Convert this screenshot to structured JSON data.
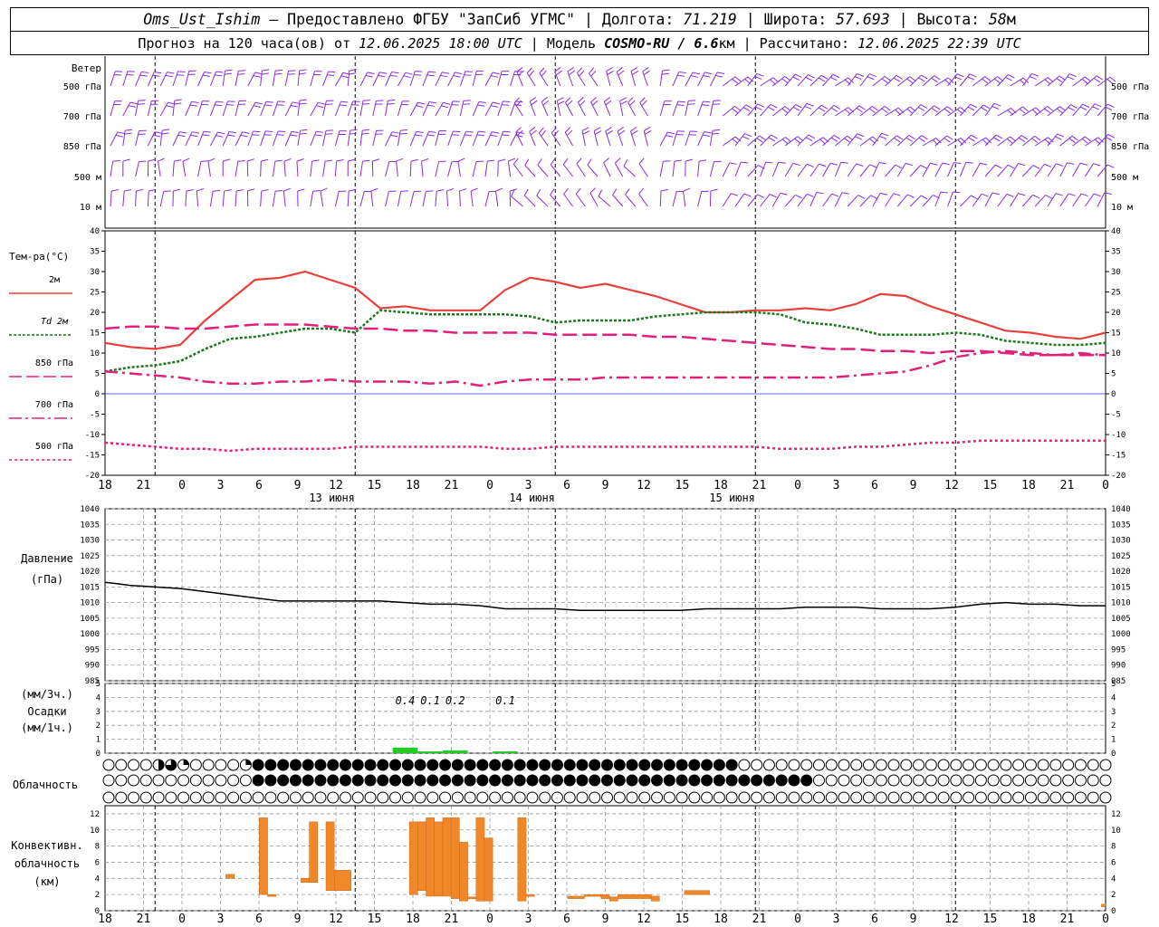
{
  "header": {
    "station": "Oms_Ust_Ishim",
    "provided": " – Предоставлено ФГБУ \"ЗапСиб УГМС\" | Долгота: ",
    "lon": "71.219",
    "lat_label": " | Широта: ",
    "lat": "57.693",
    "alt_label": " | Высота: ",
    "alt": "58",
    "alt_unit": "м",
    "forecast_label": "Прогноз на 120 часа(ов) от ",
    "forecast_time": "12.06.2025 18:00 UTC",
    "model_label": " | Модель ",
    "model": "COSMO-RU / 6.6",
    "model_unit": "км",
    "calc_label": " | Рассчитано: ",
    "calc_time": "12.06.2025 22:39 UTC"
  },
  "labels": {
    "wind": "Ветер",
    "temp": "Тем-ра(°C)",
    "pressure_1": "Давление",
    "pressure_2": "(гПа)",
    "precip_1": "(мм/3ч.)",
    "precip_2": "Осадки",
    "precip_3": "(мм/1ч.)",
    "cloud": "Облачность",
    "conv_1": "Конвективн.",
    "conv_2": "облачность",
    "conv_3": "(км)"
  },
  "wind_levels": [
    "500 гПа",
    "700 гПа",
    "850 гПа",
    "500 м",
    "10 м"
  ],
  "legend": [
    {
      "label": "2м",
      "color": "#e8403a",
      "dash": ""
    },
    {
      "label": "Td 2м",
      "color": "#1a7a1a",
      "dash": "3,2"
    },
    {
      "label": "850 гПа",
      "color": "#e0207a",
      "dash": "14,5"
    },
    {
      "label": "700 гПа",
      "color": "#e0207a",
      "dash": "14,4,3,4"
    },
    {
      "label": "500 гПа",
      "color": "#e0207a",
      "dash": "3,3"
    }
  ],
  "time_axis": {
    "hour_labels": [
      "18",
      "21",
      "0",
      "3",
      "6",
      "9",
      "12",
      "15",
      "18",
      "21",
      "0",
      "3",
      "6",
      "9",
      "12",
      "15",
      "18",
      "21",
      "0",
      "3",
      "6",
      "9",
      "12",
      "15",
      "18",
      "21",
      "0"
    ],
    "day_labels": [
      "13 июня",
      "14 июня",
      "15 июня"
    ]
  },
  "cloud_symbols": {
    "high": [
      0,
      0,
      0,
      0,
      0,
      0,
      2,
      3,
      2,
      1,
      0,
      0,
      0,
      0,
      0,
      0,
      1,
      0,
      4,
      4,
      3,
      4,
      4,
      4,
      4,
      4,
      4,
      4,
      4,
      4,
      4,
      4,
      4,
      4,
      4,
      4,
      4,
      4,
      4,
      4,
      4,
      4,
      4,
      4,
      4,
      4,
      4,
      4,
      4,
      4,
      4,
      4,
      4,
      4,
      4,
      4,
      4,
      4,
      4,
      4,
      4,
      4,
      4,
      4,
      4,
      4,
      4,
      4,
      4,
      4,
      4,
      4,
      4,
      4,
      4,
      4,
      4,
      0,
      0,
      0,
      0,
      0,
      0,
      0,
      0,
      0,
      0,
      0,
      0,
      0,
      0,
      0,
      0,
      0,
      0,
      0,
      0,
      0,
      0,
      0,
      0,
      0,
      0,
      0,
      0,
      0,
      0,
      0,
      0,
      0,
      0,
      0,
      0,
      0,
      0,
      0,
      0,
      0,
      0,
      0,
      0,
      0,
      0
    ],
    "middle": [
      0,
      0,
      0,
      0,
      0,
      0,
      0,
      0,
      0,
      0,
      0,
      0,
      0,
      0,
      0,
      0,
      0,
      2,
      4,
      4,
      4,
      4,
      4,
      4,
      4,
      4,
      4,
      4,
      4,
      4,
      4,
      4,
      4,
      4,
      4,
      4,
      4,
      4,
      4,
      4,
      4,
      4,
      4,
      4,
      4,
      4,
      4,
      4,
      4,
      4,
      4,
      4,
      4,
      4,
      4,
      4,
      4,
      4,
      4,
      4,
      4,
      4,
      4,
      4,
      4,
      4,
      4,
      4,
      4,
      4,
      4,
      4,
      4,
      4,
      4,
      4,
      4,
      4,
      4,
      4,
      4,
      4,
      4,
      4,
      4,
      4,
      0,
      0,
      0,
      0,
      0,
      0,
      0,
      0,
      0,
      0,
      0,
      0,
      0,
      0,
      0,
      0,
      0,
      0,
      0,
      0,
      0,
      0,
      0,
      0,
      0,
      0,
      0,
      0,
      0,
      0,
      0,
      0,
      0,
      0,
      0,
      0,
      0
    ],
    "low": [
      0,
      0,
      0,
      0,
      0,
      0,
      0,
      0,
      0,
      0,
      0,
      0,
      0,
      0,
      0,
      0,
      0,
      0,
      0,
      0,
      0,
      0,
      0,
      0,
      0,
      0,
      0,
      0,
      0,
      0,
      0,
      0,
      0,
      0,
      0,
      0,
      0,
      0,
      0,
      0,
      0,
      0,
      0,
      0,
      0,
      0,
      0,
      0,
      0,
      0,
      0,
      0,
      0,
      0,
      0,
      0,
      0,
      0,
      0,
      0,
      0,
      0,
      0,
      0,
      0,
      0,
      0,
      0,
      0,
      0,
      0,
      0,
      0,
      0,
      0,
      0,
      0,
      0,
      0,
      0,
      0,
      0,
      0,
      0,
      0,
      0,
      0,
      0,
      0,
      0,
      0,
      0,
      0,
      0,
      0,
      0,
      0,
      0,
      0,
      0,
      0,
      0,
      0,
      0,
      0,
      0,
      0,
      0,
      0,
      0,
      0,
      0,
      0,
      0,
      0,
      0,
      0,
      0,
      0,
      0,
      0,
      0,
      0
    ]
  },
  "chart_data": [
    {
      "type": "line",
      "title": "Тем-ра(°C)",
      "x_hours": [
        0,
        3,
        6,
        9,
        12,
        15,
        18,
        21,
        24,
        27,
        30,
        33,
        36,
        39,
        42,
        45,
        48,
        51,
        54,
        57,
        60,
        63,
        66,
        69,
        72,
        75,
        78,
        81,
        84,
        87,
        90,
        93,
        96,
        99,
        102,
        105,
        108,
        111,
        114,
        117,
        120
      ],
      "ylim": [
        -20,
        40
      ],
      "series": [
        {
          "name": "2м",
          "values": [
            12.5,
            11.5,
            11,
            12,
            18,
            23,
            28,
            28.5,
            30,
            28,
            26,
            21,
            21.5,
            20.5,
            20.5,
            20.5,
            25.5,
            28.5,
            27.5,
            26,
            27,
            25.5,
            24,
            22,
            20,
            20,
            20.5,
            20.5,
            21,
            20.5,
            22,
            24.5,
            24,
            21.5,
            19.5,
            17.5,
            15.5,
            15,
            14,
            13.5,
            15
          ]
        },
        {
          "name": "Td 2м",
          "values": [
            5.5,
            6.5,
            7,
            8,
            11,
            13.5,
            14,
            15,
            16,
            16,
            15,
            20.5,
            20,
            19.5,
            19.5,
            19.5,
            19.5,
            19,
            17.5,
            18,
            18,
            18,
            19,
            19.5,
            20,
            20,
            20,
            19.5,
            17.5,
            17,
            16,
            14.5,
            14.5,
            14.5,
            15,
            14.5,
            13,
            12.5,
            12,
            12,
            12.5
          ]
        },
        {
          "name": "850 гПа",
          "values": [
            16,
            16.5,
            16.5,
            16,
            16,
            16.5,
            17,
            17,
            17,
            16.5,
            16,
            16,
            15.5,
            15.5,
            15,
            15,
            15,
            15,
            14.5,
            14.5,
            14.5,
            14.5,
            14,
            14,
            13.5,
            13,
            12.5,
            12,
            11.5,
            11,
            11,
            10.5,
            10.5,
            10,
            10.5,
            10.5,
            10,
            9.5,
            9.5,
            9.5,
            9.5
          ]
        },
        {
          "name": "700 гПа",
          "values": [
            5.5,
            5,
            4.5,
            4,
            3,
            2.5,
            2.5,
            3,
            3,
            3.5,
            3,
            3,
            3,
            2.5,
            3,
            2,
            3,
            3.5,
            3.5,
            3.5,
            4,
            4,
            4,
            4,
            4,
            4,
            4,
            4,
            4,
            4,
            4.5,
            5,
            5.5,
            7,
            9,
            10,
            10.5,
            10,
            9.5,
            10,
            9.5
          ]
        },
        {
          "name": "500 гПа",
          "values": [
            -12,
            -12.5,
            -13,
            -13.5,
            -13.5,
            -14,
            -13.5,
            -13.5,
            -13.5,
            -13.5,
            -13,
            -13,
            -13,
            -13,
            -13,
            -13,
            -13.5,
            -13.5,
            -13,
            -13,
            -13,
            -13,
            -13,
            -13,
            -13,
            -13,
            -13,
            -13.5,
            -13.5,
            -13.5,
            -13,
            -13,
            -12.5,
            -12,
            -12,
            -11.5,
            -11.5,
            -11.5,
            -11.5,
            -11.5,
            -11.5
          ]
        }
      ]
    },
    {
      "type": "line",
      "title": "Давление (гПа)",
      "x_hours": [
        0,
        3,
        6,
        9,
        12,
        15,
        18,
        21,
        24,
        27,
        30,
        33,
        36,
        39,
        42,
        45,
        48,
        51,
        54,
        57,
        60,
        63,
        66,
        69,
        72,
        75,
        78,
        81,
        84,
        87,
        90,
        93,
        96,
        99,
        102,
        105,
        108,
        111,
        114,
        117,
        120
      ],
      "ylim": [
        985,
        1040
      ],
      "series": [
        {
          "name": "Давление",
          "values": [
            1016.5,
            1015.5,
            1015,
            1014.5,
            1013.5,
            1012.5,
            1011.5,
            1010.5,
            1010.5,
            1010.5,
            1010.5,
            1010.5,
            1010,
            1009.5,
            1009.5,
            1009,
            1008,
            1008,
            1008,
            1007.5,
            1007.5,
            1007.5,
            1007.5,
            1007.5,
            1008,
            1008,
            1008,
            1008,
            1008.5,
            1008.5,
            1008.5,
            1008,
            1008,
            1008,
            1008.5,
            1009.5,
            1010,
            1009.5,
            1009.5,
            1009,
            1009
          ]
        }
      ]
    },
    {
      "type": "bar",
      "title": "Осадки (мм/3ч.) (мм/1ч.)",
      "ylim": [
        0,
        5
      ],
      "bars": [
        {
          "x": 36,
          "value": 0.4,
          "label": "0.4"
        },
        {
          "x": 39,
          "value": 0.1,
          "label": "0.1"
        },
        {
          "x": 42,
          "value": 0.2,
          "label": "0.2"
        },
        {
          "x": 48,
          "value": 0.1,
          "label": "0.1"
        }
      ]
    },
    {
      "type": "bar",
      "title": "Конвективн. облачность (км)",
      "ylim": [
        0,
        13
      ],
      "segments": [
        {
          "x0": 14.5,
          "x1": 15.5,
          "bottom": 4,
          "top": 4.5
        },
        {
          "x0": 18.5,
          "x1": 19.5,
          "bottom": 2,
          "top": 11.5
        },
        {
          "x0": 19.5,
          "x1": 20.5,
          "bottom": 1.8,
          "top": 2
        },
        {
          "x0": 23.5,
          "x1": 24.5,
          "bottom": 3.5,
          "top": 4
        },
        {
          "x0": 24.5,
          "x1": 25.5,
          "bottom": 3.5,
          "top": 11
        },
        {
          "x0": 26.5,
          "x1": 27.5,
          "bottom": 2.5,
          "top": 11
        },
        {
          "x0": 27.5,
          "x1": 29.5,
          "bottom": 2.5,
          "top": 5
        },
        {
          "x0": 36.5,
          "x1": 37.5,
          "bottom": 2,
          "top": 11
        },
        {
          "x0": 37.5,
          "x1": 38.5,
          "bottom": 2.5,
          "top": 11
        },
        {
          "x0": 38.5,
          "x1": 39.5,
          "bottom": 1.8,
          "top": 11.5
        },
        {
          "x0": 39.5,
          "x1": 40.5,
          "bottom": 1.8,
          "top": 11
        },
        {
          "x0": 40.5,
          "x1": 41.5,
          "bottom": 1.8,
          "top": 11.5
        },
        {
          "x0": 41.5,
          "x1": 42.5,
          "bottom": 1.5,
          "top": 11.5
        },
        {
          "x0": 42.5,
          "x1": 43.5,
          "bottom": 1.2,
          "top": 8.5
        },
        {
          "x0": 43.5,
          "x1": 44.5,
          "bottom": 1.5,
          "top": 1.7
        },
        {
          "x0": 44.5,
          "x1": 45.5,
          "bottom": 1.2,
          "top": 11.5
        },
        {
          "x0": 45.5,
          "x1": 46.5,
          "bottom": 1.2,
          "top": 9
        },
        {
          "x0": 49.5,
          "x1": 50.5,
          "bottom": 1.2,
          "top": 11.5
        },
        {
          "x0": 50.5,
          "x1": 51.5,
          "bottom": 1.8,
          "top": 2
        },
        {
          "x0": 55.5,
          "x1": 57.5,
          "bottom": 1.5,
          "top": 1.8
        },
        {
          "x0": 57.5,
          "x1": 59.5,
          "bottom": 1.8,
          "top": 2
        },
        {
          "x0": 59.5,
          "x1": 60.5,
          "bottom": 1.5,
          "top": 2
        },
        {
          "x0": 60.5,
          "x1": 61.5,
          "bottom": 1.2,
          "top": 1.7
        },
        {
          "x0": 61.5,
          "x1": 65.5,
          "bottom": 1.5,
          "top": 2
        },
        {
          "x0": 65.5,
          "x1": 66.5,
          "bottom": 1.2,
          "top": 1.8
        },
        {
          "x0": 69.5,
          "x1": 72.5,
          "bottom": 2,
          "top": 2.5
        },
        {
          "x0": 119.5,
          "x1": 120,
          "bottom": 0.5,
          "top": 0.8
        }
      ]
    }
  ],
  "colors": {
    "wind": "#8a2be2",
    "t2m": "#e8403a",
    "td": "#1a7a1a",
    "upper": "#e0207a",
    "precip": "#22cc22",
    "conv": "#f0882a",
    "zero_line": "#3333ff"
  }
}
